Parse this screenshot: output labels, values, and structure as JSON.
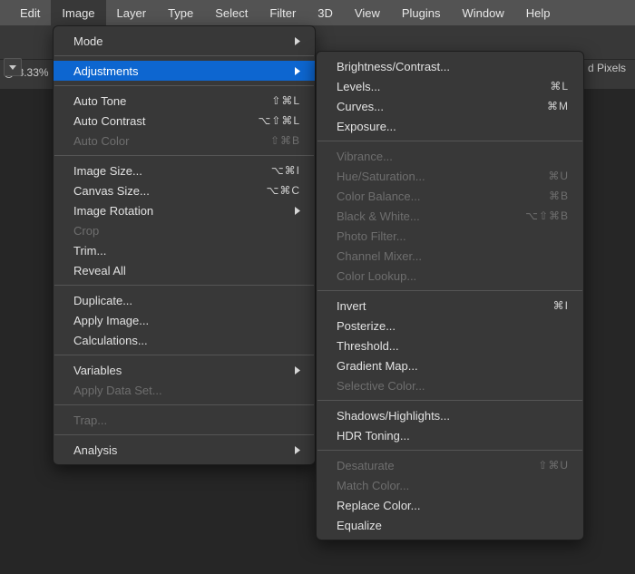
{
  "menubar": {
    "items": [
      {
        "label": "Edit"
      },
      {
        "label": "Image",
        "active": true
      },
      {
        "label": "Layer"
      },
      {
        "label": "Type"
      },
      {
        "label": "Select"
      },
      {
        "label": "Filter"
      },
      {
        "label": "3D"
      },
      {
        "label": "View"
      },
      {
        "label": "Plugins"
      },
      {
        "label": "Window"
      },
      {
        "label": "Help"
      }
    ]
  },
  "status": {
    "zoom": "@ 8.33%",
    "pixels_label_fragment": "d Pixels"
  },
  "image_menu": {
    "groups": [
      [
        {
          "label": "Mode",
          "submenu": true
        }
      ],
      [
        {
          "label": "Adjustments",
          "submenu": true,
          "highlight": true
        }
      ],
      [
        {
          "label": "Auto Tone",
          "shortcut": "⇧⌘L"
        },
        {
          "label": "Auto Contrast",
          "shortcut": "⌥⇧⌘L"
        },
        {
          "label": "Auto Color",
          "shortcut": "⇧⌘B",
          "disabled": true
        }
      ],
      [
        {
          "label": "Image Size...",
          "shortcut": "⌥⌘I"
        },
        {
          "label": "Canvas Size...",
          "shortcut": "⌥⌘C"
        },
        {
          "label": "Image Rotation",
          "submenu": true
        },
        {
          "label": "Crop",
          "disabled": true
        },
        {
          "label": "Trim..."
        },
        {
          "label": "Reveal All"
        }
      ],
      [
        {
          "label": "Duplicate..."
        },
        {
          "label": "Apply Image..."
        },
        {
          "label": "Calculations..."
        }
      ],
      [
        {
          "label": "Variables",
          "submenu": true
        },
        {
          "label": "Apply Data Set...",
          "disabled": true
        }
      ],
      [
        {
          "label": "Trap...",
          "disabled": true
        }
      ],
      [
        {
          "label": "Analysis",
          "submenu": true
        }
      ]
    ]
  },
  "adjustments_menu": {
    "groups": [
      [
        {
          "label": "Brightness/Contrast..."
        },
        {
          "label": "Levels...",
          "shortcut": "⌘L"
        },
        {
          "label": "Curves...",
          "shortcut": "⌘M"
        },
        {
          "label": "Exposure..."
        }
      ],
      [
        {
          "label": "Vibrance...",
          "disabled": true
        },
        {
          "label": "Hue/Saturation...",
          "shortcut": "⌘U",
          "disabled": true
        },
        {
          "label": "Color Balance...",
          "shortcut": "⌘B",
          "disabled": true
        },
        {
          "label": "Black & White...",
          "shortcut": "⌥⇧⌘B",
          "disabled": true
        },
        {
          "label": "Photo Filter...",
          "disabled": true
        },
        {
          "label": "Channel Mixer...",
          "disabled": true
        },
        {
          "label": "Color Lookup...",
          "disabled": true
        }
      ],
      [
        {
          "label": "Invert",
          "shortcut": "⌘I"
        },
        {
          "label": "Posterize..."
        },
        {
          "label": "Threshold..."
        },
        {
          "label": "Gradient Map..."
        },
        {
          "label": "Selective Color...",
          "disabled": true
        }
      ],
      [
        {
          "label": "Shadows/Highlights..."
        },
        {
          "label": "HDR Toning..."
        }
      ],
      [
        {
          "label": "Desaturate",
          "shortcut": "⇧⌘U",
          "disabled": true
        },
        {
          "label": "Match Color...",
          "disabled": true
        },
        {
          "label": "Replace Color..."
        },
        {
          "label": "Equalize"
        }
      ]
    ]
  }
}
